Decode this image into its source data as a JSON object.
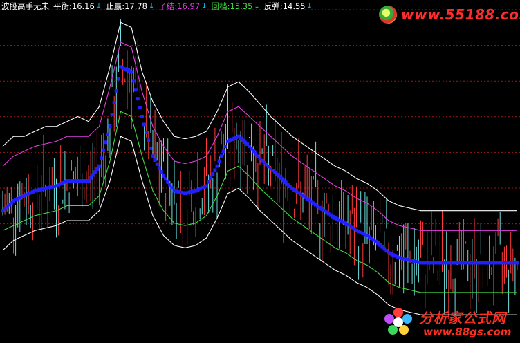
{
  "header": {
    "indicator_name": "波段高手无未",
    "items": [
      {
        "label": "平衡:",
        "value": "16.16",
        "color": "#ffffff",
        "arrow": "↓"
      },
      {
        "label": "止赢:",
        "value": "17.78",
        "color": "#ffffff",
        "arrow": "↓"
      },
      {
        "label": "了结:",
        "value": "16.97",
        "color": "#e040e0",
        "arrow": "↓"
      },
      {
        "label": "回档:",
        "value": "15.35",
        "color": "#40e040",
        "arrow": "↓"
      },
      {
        "label": "反弹:",
        "value": "14.55",
        "color": "#ffffff",
        "arrow": "↓"
      }
    ]
  },
  "watermark_top": {
    "text": "www.55188.com",
    "icon": "spiral-logo-icon"
  },
  "watermark_bottom": {
    "text": "分析家公式网",
    "url": "www.88gs.com",
    "icon": "flower-logo-icon"
  },
  "colors": {
    "background": "#000000",
    "grid": "#a01818",
    "up_candle": "#ff3c3c",
    "down_candle": "#70e0e0",
    "upper_band": "#ffffff",
    "mid_upper": "#e040e0",
    "center_dots": "#2020ff",
    "lower_mid": "#40e040",
    "lower_band": "#ffffff"
  },
  "chart_data": {
    "type": "line",
    "title": "",
    "xlabel": "",
    "ylabel": "",
    "grid": true,
    "last_values": {
      "平衡": 16.16,
      "止赢": 17.78,
      "了结": 16.97,
      "回档": 15.35,
      "反弹": 14.55
    },
    "ylim": [
      13.4,
      19.4
    ],
    "x": [
      0,
      5,
      10,
      15,
      20,
      25,
      30,
      35,
      40,
      45,
      50,
      55,
      60,
      65,
      70,
      75,
      80,
      85,
      90,
      95,
      100,
      105,
      110,
      115,
      120,
      125,
      130,
      135,
      140,
      145,
      150,
      155,
      160,
      165,
      170,
      175,
      180,
      185,
      190,
      195,
      200,
      205,
      210,
      215,
      220,
      225,
      230,
      235,
      240
    ],
    "series": [
      {
        "name": "止赢",
        "values": [
          16.7,
          16.9,
          16.9,
          17.0,
          17.1,
          17.1,
          17.2,
          17.3,
          17.2,
          17.5,
          18.3,
          19.2,
          19.1,
          18.2,
          17.6,
          17.2,
          16.9,
          16.85,
          16.9,
          17.0,
          17.4,
          17.9,
          18.0,
          17.8,
          17.55,
          17.3,
          17.1,
          16.9,
          16.75,
          16.6,
          16.45,
          16.3,
          16.2,
          16.05,
          15.95,
          15.8,
          15.6,
          15.5,
          15.45,
          15.4,
          15.4,
          15.4,
          15.4,
          15.4,
          15.4,
          15.4,
          15.4,
          15.4,
          15.4
        ]
      },
      {
        "name": "了结",
        "values": [
          16.3,
          16.5,
          16.6,
          16.7,
          16.75,
          16.8,
          16.9,
          16.9,
          16.9,
          17.1,
          17.9,
          18.8,
          18.7,
          17.8,
          17.1,
          16.7,
          16.4,
          16.35,
          16.4,
          16.5,
          16.9,
          17.4,
          17.5,
          17.3,
          17.1,
          16.9,
          16.7,
          16.5,
          16.35,
          16.2,
          16.05,
          15.9,
          15.8,
          15.65,
          15.55,
          15.4,
          15.2,
          15.1,
          15.05,
          15.0,
          15.0,
          15.0,
          15.0,
          15.0,
          15.0,
          15.0,
          15.0,
          15.0,
          15.0
        ]
      },
      {
        "name": "平衡",
        "values": [
          15.4,
          15.6,
          15.7,
          15.8,
          15.85,
          15.9,
          16.0,
          16.0,
          16.0,
          16.3,
          17.1,
          18.3,
          18.2,
          17.3,
          16.5,
          16.1,
          15.8,
          15.75,
          15.8,
          15.9,
          16.3,
          16.8,
          16.9,
          16.7,
          16.45,
          16.25,
          16.05,
          15.85,
          15.7,
          15.55,
          15.4,
          15.25,
          15.15,
          15.0,
          14.9,
          14.75,
          14.55,
          14.45,
          14.4,
          14.35,
          14.35,
          14.35,
          14.35,
          14.35,
          14.35,
          14.35,
          14.35,
          14.35,
          14.35
        ]
      },
      {
        "name": "回档",
        "values": [
          15.0,
          15.1,
          15.2,
          15.3,
          15.35,
          15.4,
          15.5,
          15.5,
          15.5,
          15.7,
          16.4,
          17.4,
          17.3,
          16.5,
          15.8,
          15.4,
          15.15,
          15.1,
          15.15,
          15.3,
          15.7,
          16.2,
          16.3,
          16.1,
          15.85,
          15.65,
          15.45,
          15.25,
          15.1,
          14.95,
          14.8,
          14.65,
          14.55,
          14.4,
          14.3,
          14.15,
          13.95,
          13.85,
          13.8,
          13.75,
          13.75,
          13.75,
          13.75,
          13.75,
          13.75,
          13.75,
          13.75,
          13.75,
          13.75
        ]
      },
      {
        "name": "反弹",
        "values": [
          14.6,
          14.8,
          14.9,
          15.0,
          15.05,
          15.1,
          15.2,
          15.2,
          15.2,
          15.4,
          16.0,
          16.9,
          16.8,
          16.0,
          15.3,
          14.9,
          14.7,
          14.65,
          14.7,
          14.85,
          15.25,
          15.75,
          15.85,
          15.65,
          15.4,
          15.2,
          15.0,
          14.8,
          14.65,
          14.5,
          14.35,
          14.2,
          14.1,
          13.95,
          13.85,
          13.7,
          13.5,
          13.4,
          13.35,
          13.3,
          13.3,
          13.3,
          13.3,
          13.3,
          13.3,
          13.3,
          13.3,
          13.3,
          13.3
        ]
      }
    ]
  }
}
